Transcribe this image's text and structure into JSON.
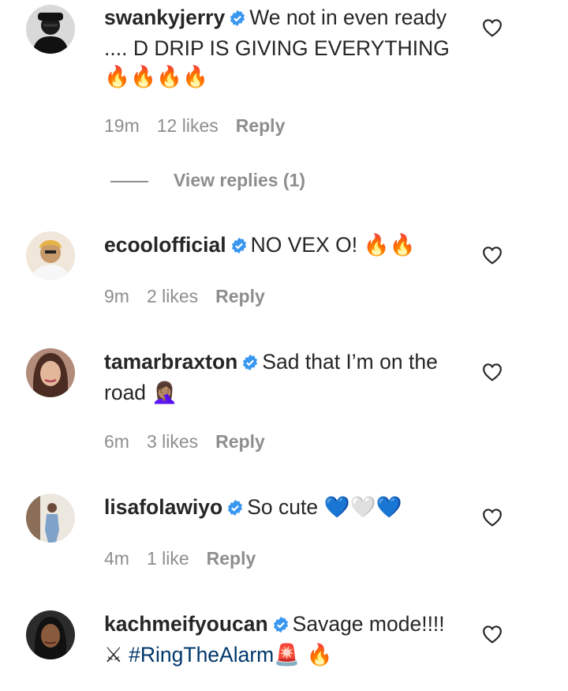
{
  "comments": [
    {
      "username": "swankyjerry",
      "text": "We not in even ready .... D DRIP IS GIVING EVERYTHING",
      "emoji": "🔥🔥🔥🔥",
      "time": "19m",
      "likes": "12 likes",
      "reply": "Reply",
      "view_replies": "View replies (1)"
    },
    {
      "username": "ecoolofficial",
      "text": "NO VEX O!",
      "emoji": "🔥🔥",
      "time": "9m",
      "likes": "2 likes",
      "reply": "Reply"
    },
    {
      "username": "tamarbraxton",
      "text": "Sad that I’m on the road",
      "emoji": "🤦🏽‍♀️",
      "time": "6m",
      "likes": "3 likes",
      "reply": "Reply"
    },
    {
      "username": "lisafolawiyo",
      "text": "So cute",
      "emoji": "💙🤍💙",
      "time": "4m",
      "likes": "1 like",
      "reply": "Reply"
    },
    {
      "username": "kachmeifyoucan",
      "text": "Savage mode!!!!",
      "emoji_prefix": "⚔",
      "hashtag": "#RingTheAlarm",
      "emoji": "🚨 🔥"
    }
  ],
  "colors": {
    "text": "#262626",
    "meta": "#8e8e8e",
    "verified": "#3897f0",
    "hashtag": "#00376b"
  },
  "icons": [
    "verified-badge-icon",
    "heart-outline-icon"
  ]
}
